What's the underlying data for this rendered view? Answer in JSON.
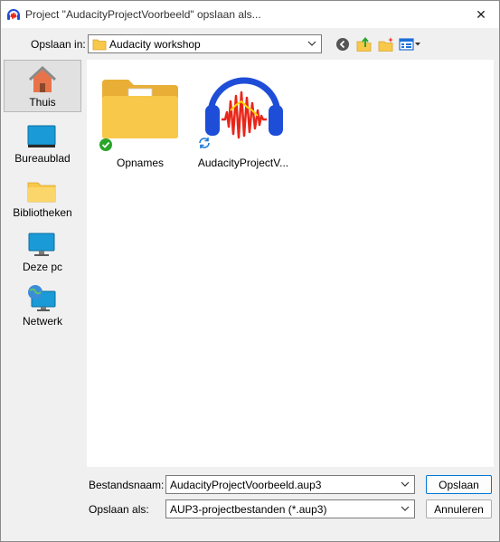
{
  "window": {
    "title": "Project \"AudacityProjectVoorbeeld\" opslaan als...",
    "close_glyph": "✕"
  },
  "toolbar": {
    "lookin_label": "Opslaan in:",
    "current_folder": "Audacity workshop",
    "buttons": [
      "back-icon",
      "up-folder-icon",
      "new-folder-icon",
      "view-menu-icon"
    ]
  },
  "places": [
    {
      "label": "Thuis",
      "icon": "home-icon",
      "selected": true
    },
    {
      "label": "Bureaublad",
      "icon": "desktop-icon",
      "selected": false
    },
    {
      "label": "Bibliotheken",
      "icon": "libraries-icon",
      "selected": false
    },
    {
      "label": "Deze pc",
      "icon": "this-pc-icon",
      "selected": false
    },
    {
      "label": "Netwerk",
      "icon": "network-icon",
      "selected": false
    }
  ],
  "files": [
    {
      "name": "Opnames",
      "type": "folder",
      "status": "synced"
    },
    {
      "name": "AudacityProjectV...",
      "type": "audacity-project",
      "status": "syncing"
    }
  ],
  "bottom": {
    "filename_label": "Bestandsnaam:",
    "filename_value": "AudacityProjectVoorbeeld.aup3",
    "filetype_label": "Opslaan als:",
    "filetype_value": "AUP3-projectbestanden (*.aup3)",
    "save_label": "Opslaan",
    "cancel_label": "Annuleren"
  },
  "colors": {
    "accent": "#0078d4",
    "folder": "#f8c84a",
    "audacity_blue": "#1e4ed8",
    "audacity_wave": "#e8261a",
    "sync_green": "#2aa52a"
  }
}
